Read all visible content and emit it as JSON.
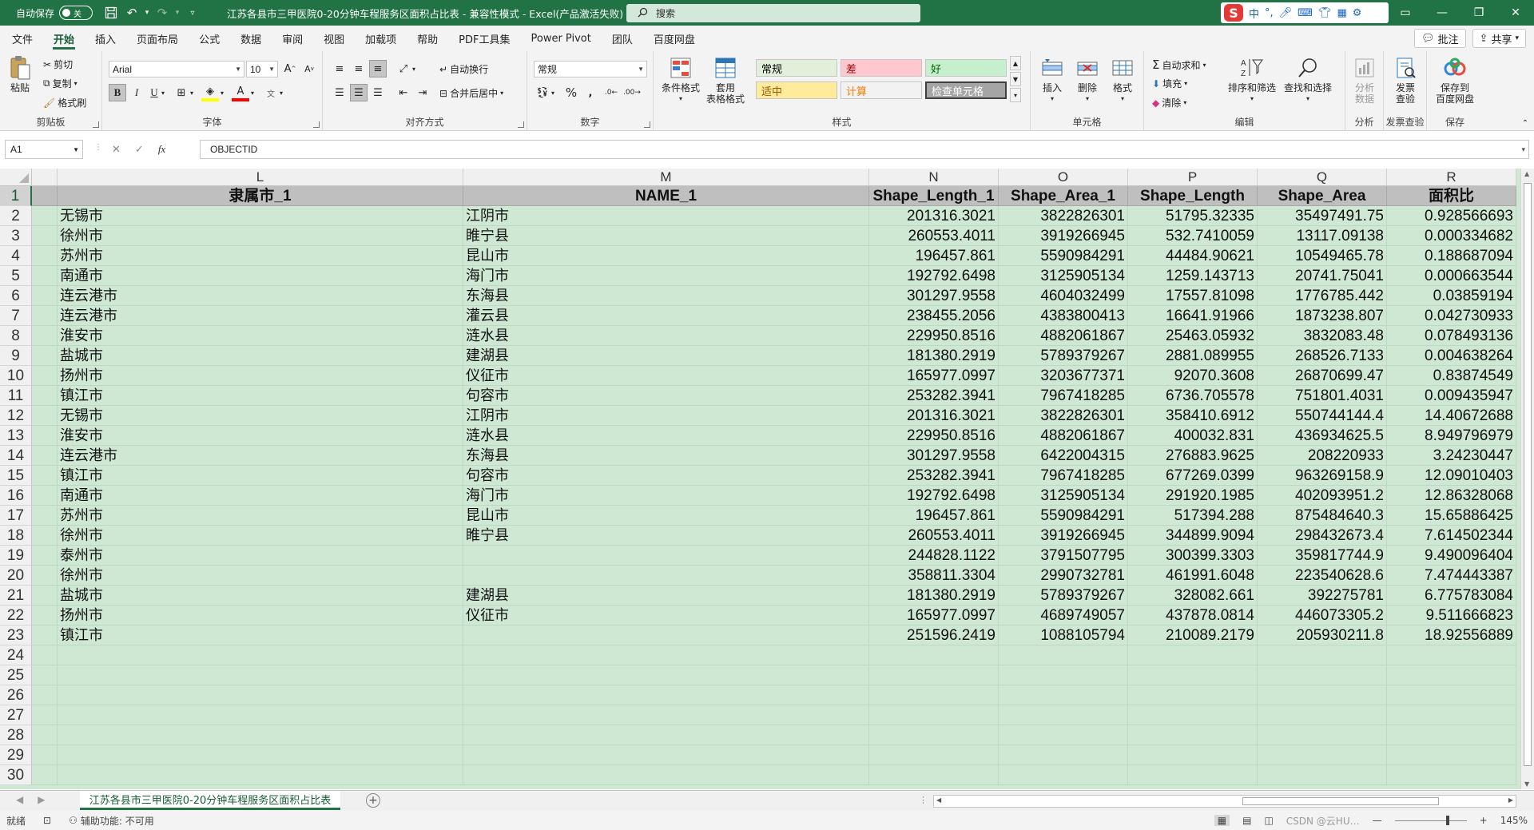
{
  "titlebar": {
    "autosave_label": "自动保存",
    "autosave_state": "关",
    "title": "江苏各县市三甲医院0-20分钟车程服务区面积占比表  -  兼容性模式  -  Excel(产品激活失败)",
    "search_placeholder": "搜索",
    "ime_text": "中"
  },
  "menu": {
    "tabs": [
      "文件",
      "开始",
      "插入",
      "页面布局",
      "公式",
      "数据",
      "审阅",
      "视图",
      "加载项",
      "帮助",
      "PDF工具集",
      "Power Pivot",
      "团队",
      "百度网盘"
    ],
    "active_tab": "开始",
    "comment_label": "批注",
    "share_label": "共享"
  },
  "ribbon": {
    "clipboard": {
      "label": "剪贴板",
      "paste": "粘贴",
      "cut": "剪切",
      "copy": "复制",
      "format_painter": "格式刷"
    },
    "font": {
      "label": "字体",
      "font_name": "Arial",
      "font_size": "10"
    },
    "alignment": {
      "label": "对齐方式",
      "wrap_text": "自动换行",
      "merge_center": "合并后居中"
    },
    "number": {
      "label": "数字",
      "format": "常规"
    },
    "styles": {
      "label": "样式",
      "conditional": "条件格式",
      "table_format": "套用\n表格格式",
      "cells": [
        {
          "text": "常规",
          "bg": "#e2efda",
          "color": "#000000"
        },
        {
          "text": "差",
          "bg": "#ffc7ce",
          "color": "#9c0006"
        },
        {
          "text": "好",
          "bg": "#c6efce",
          "color": "#006100"
        },
        {
          "text": "适中",
          "bg": "#ffeb9c",
          "color": "#9c5700"
        },
        {
          "text": "计算",
          "bg": "#f2f2f2",
          "color": "#fa7d00"
        },
        {
          "text": "检查单元格",
          "bg": "#a5a5a5",
          "color": "#ffffff"
        }
      ]
    },
    "cells_group": {
      "label": "单元格",
      "insert": "插入",
      "delete": "删除",
      "format": "格式"
    },
    "editing": {
      "label": "编辑",
      "autosum": "自动求和",
      "fill": "填充",
      "clear": "清除",
      "sort_filter": "排序和筛选",
      "find_select": "查找和选择"
    },
    "analysis": {
      "label": "分析",
      "analyze_data": "分析\n数据"
    },
    "invoice": {
      "label": "发票查验",
      "button": "发票\n查验"
    },
    "save": {
      "label": "保存",
      "button": "保存到\n百度网盘"
    }
  },
  "formula_bar": {
    "name_box": "A1",
    "formula": "OBJECTID",
    "fx": "fx"
  },
  "sheet": {
    "columns": [
      "L",
      "M",
      "N",
      "O",
      "P",
      "Q",
      "R"
    ],
    "row_numbers": [
      "1",
      "2",
      "3",
      "4",
      "5",
      "6",
      "7",
      "8",
      "9",
      "10",
      "11",
      "12",
      "13",
      "14",
      "15",
      "16",
      "17",
      "18",
      "19",
      "20",
      "21",
      "22",
      "23",
      "24",
      "25",
      "26",
      "27",
      "28",
      "29",
      "30"
    ],
    "headers": [
      "隶属市_1",
      "NAME_1",
      "Shape_Length_1",
      "Shape_Area_1",
      "Shape_Length",
      "Shape_Area",
      "面积比"
    ],
    "rows": [
      [
        "无锡市",
        "江阴市",
        "201316.3021",
        "3822826301",
        "51795.32335",
        "35497491.75",
        "0.928566693"
      ],
      [
        "徐州市",
        "睢宁县",
        "260553.4011",
        "3919266945",
        "532.7410059",
        "13117.09138",
        "0.000334682"
      ],
      [
        "苏州市",
        "昆山市",
        "196457.861",
        "5590984291",
        "44484.90621",
        "10549465.78",
        "0.188687094"
      ],
      [
        "南通市",
        "海门市",
        "192792.6498",
        "3125905134",
        "1259.143713",
        "20741.75041",
        "0.000663544"
      ],
      [
        "连云港市",
        "东海县",
        "301297.9558",
        "4604032499",
        "17557.81098",
        "1776785.442",
        "0.03859194"
      ],
      [
        "连云港市",
        "灌云县",
        "238455.2056",
        "4383800413",
        "16641.91966",
        "1873238.807",
        "0.042730933"
      ],
      [
        "淮安市",
        "涟水县",
        "229950.8516",
        "4882061867",
        "25463.05932",
        "3832083.48",
        "0.078493136"
      ],
      [
        "盐城市",
        "建湖县",
        "181380.2919",
        "5789379267",
        "2881.089955",
        "268526.7133",
        "0.004638264"
      ],
      [
        "扬州市",
        "仪征市",
        "165977.0997",
        "3203677371",
        "92070.3608",
        "26870699.47",
        "0.83874549"
      ],
      [
        "镇江市",
        "句容市",
        "253282.3941",
        "7967418285",
        "6736.705578",
        "751801.4031",
        "0.009435947"
      ],
      [
        "无锡市",
        "江阴市",
        "201316.3021",
        "3822826301",
        "358410.6912",
        "550744144.4",
        "14.40672688"
      ],
      [
        "淮安市",
        "涟水县",
        "229950.8516",
        "4882061867",
        "400032.831",
        "436934625.5",
        "8.949796979"
      ],
      [
        "连云港市",
        "东海县",
        "301297.9558",
        "6422004315",
        "276883.9625",
        "208220933",
        "3.24230447"
      ],
      [
        "镇江市",
        "句容市",
        "253282.3941",
        "7967418285",
        "677269.0399",
        "963269158.9",
        "12.09010403"
      ],
      [
        "南通市",
        "海门市",
        "192792.6498",
        "3125905134",
        "291920.1985",
        "402093951.2",
        "12.86328068"
      ],
      [
        "苏州市",
        "昆山市",
        "196457.861",
        "5590984291",
        "517394.288",
        "875484640.3",
        "15.65886425"
      ],
      [
        "徐州市",
        "睢宁县",
        "260553.4011",
        "3919266945",
        "344899.9094",
        "298432673.4",
        "7.614502344"
      ],
      [
        "泰州市",
        "",
        "244828.1122",
        "3791507795",
        "300399.3303",
        "359817744.9",
        "9.490096404"
      ],
      [
        "徐州市",
        "",
        "358811.3304",
        "2990732781",
        "461991.6048",
        "223540628.6",
        "7.474443387"
      ],
      [
        "盐城市",
        "建湖县",
        "181380.2919",
        "5789379267",
        "328082.661",
        "392275781",
        "6.775783084"
      ],
      [
        "扬州市",
        "仪征市",
        "165977.0997",
        "4689749057",
        "437878.0814",
        "446073305.2",
        "9.511666823"
      ],
      [
        "镇江市",
        "",
        "251596.2419",
        "1088105794",
        "210089.2179",
        "205930211.8",
        "18.92556889"
      ]
    ]
  },
  "sheet_tabs": {
    "active": "江苏各县市三甲医院0-20分钟车程服务区面积占比表"
  },
  "status": {
    "ready": "就绪",
    "accessibility": "辅助功能: 不可用",
    "watermark": "CSDN @云HU…",
    "zoom": "145%"
  },
  "colors": {
    "excel_green": "#217346",
    "cell_fill": "#cfe8d3",
    "header_fill": "#bfbfbf"
  }
}
